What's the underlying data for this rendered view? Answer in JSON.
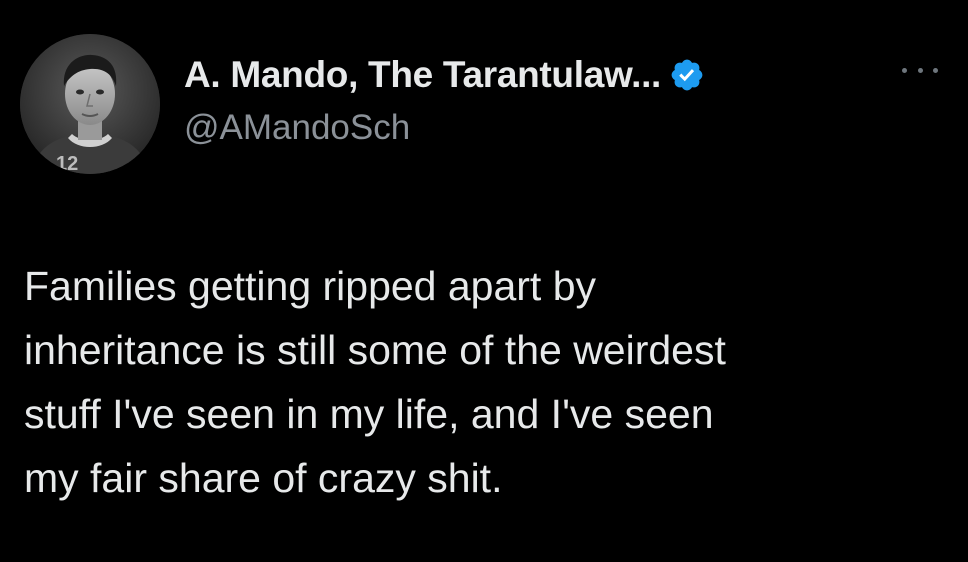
{
  "author": {
    "display_name": "A. Mando, The Tarantulaw...",
    "handle": "@AMandoSch",
    "verified_icon": "verified-badge-icon",
    "avatar": "profile-photo"
  },
  "tweet": {
    "lines": [
      "Families getting ripped apart by",
      "inheritance is still some of the weirdest",
      "stuff I've seen in my life, and I've seen",
      "my fair share of crazy shit."
    ]
  },
  "menu": {
    "icon": "more-options-icon"
  },
  "colors": {
    "background": "#000000",
    "text": "#e7e9ea",
    "secondary_text": "#8b9198",
    "verified_blue": "#1d9bf0"
  }
}
